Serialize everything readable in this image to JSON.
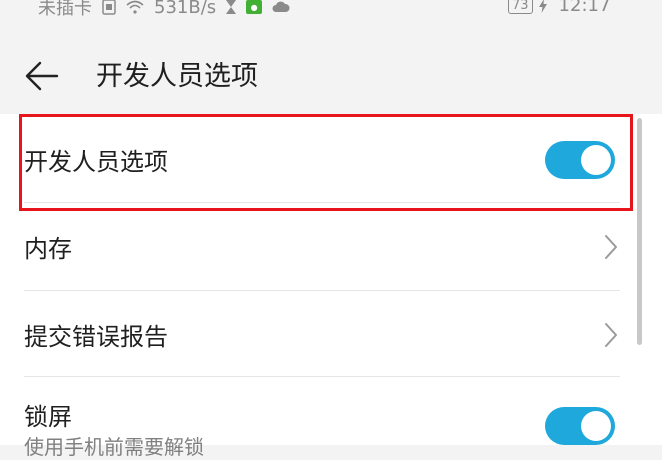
{
  "statusbar": {
    "carrier": "未插卡",
    "network_speed": "531B/s",
    "battery": "73",
    "time": "12:17"
  },
  "header": {
    "title": "开发人员选项"
  },
  "settings": [
    {
      "label": "开发人员选项",
      "type": "toggle",
      "on": true
    },
    {
      "label": "内存",
      "type": "link"
    },
    {
      "label": "提交错误报告",
      "type": "link"
    },
    {
      "label": "锁屏",
      "sublabel": "使用手机前需要解锁",
      "type": "toggle",
      "on": true
    }
  ],
  "colors": {
    "accent": "#1ea8dc",
    "highlight": "#e8141c",
    "background": "#f3f3f3"
  },
  "icons": [
    "back-arrow-icon",
    "sim-icon",
    "wifi-icon",
    "hourglass-icon",
    "wechat-icon",
    "cloud-icon",
    "charging-icon",
    "chevron-right-icon"
  ]
}
